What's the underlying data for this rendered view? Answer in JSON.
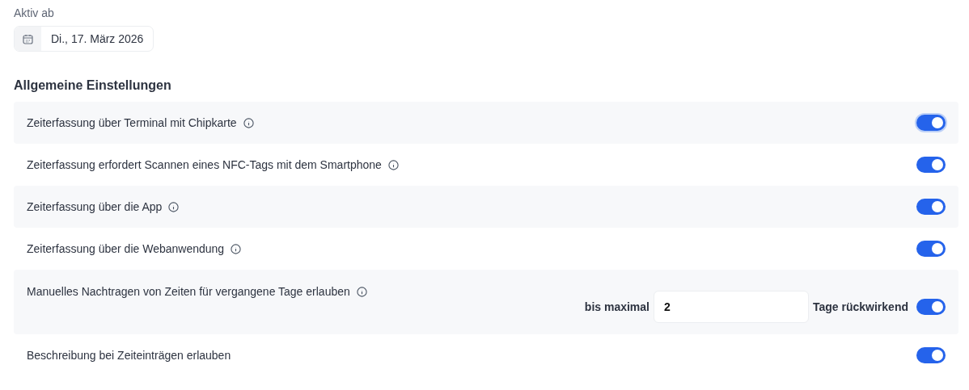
{
  "active_from": {
    "label": "Aktiv ab",
    "date": "Di., 17. März 2026"
  },
  "section_title": "Allgemeine Einstellungen",
  "settings": [
    {
      "label": "Zeiterfassung über Terminal mit Chipkarte",
      "info": true,
      "on": true,
      "focused": true
    },
    {
      "label": "Zeiterfassung erfordert Scannen eines NFC-Tags mit dem Smartphone",
      "info": true,
      "on": true,
      "focused": false
    },
    {
      "label": "Zeiterfassung über die App",
      "info": true,
      "on": true,
      "focused": false
    },
    {
      "label": "Zeiterfassung über die Webanwendung",
      "info": true,
      "on": true,
      "focused": false
    },
    {
      "label": "Manuelles Nachtragen von Zeiten für vergangene Tage erlauben",
      "info": true,
      "on": true,
      "focused": false,
      "extra": {
        "prefix": "bis maximal",
        "value": "2",
        "suffix": "Tage rückwirkend"
      }
    },
    {
      "label": "Beschreibung bei Zeiteinträgen erlauben",
      "info": false,
      "on": true,
      "focused": false
    }
  ]
}
